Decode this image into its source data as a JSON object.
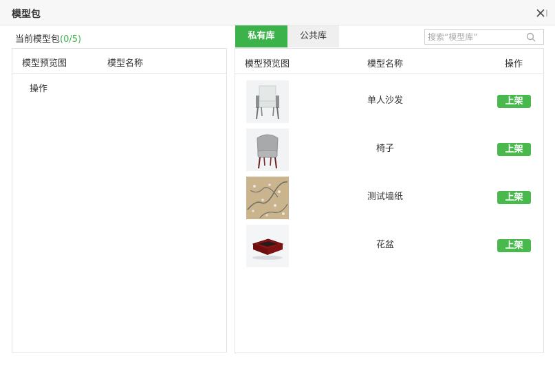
{
  "dialog": {
    "title": "模型包",
    "close_icon": "close-icon"
  },
  "left": {
    "caption_prefix": "当前模型包",
    "caption_count": "(0/5)",
    "headers": [
      "模型预览图",
      "模型名称"
    ],
    "op_label": "操作"
  },
  "tabs": [
    {
      "label": "私有库",
      "active": true
    },
    {
      "label": "公共库",
      "active": false
    }
  ],
  "search": {
    "placeholder": "搜索“模型库”",
    "value": "",
    "icon": "search-icon"
  },
  "right": {
    "headers": [
      "模型预览图",
      "模型名称",
      "操作"
    ],
    "rows": [
      {
        "name": "单人沙发",
        "action": "上架",
        "thumb": "white-armchair"
      },
      {
        "name": "椅子",
        "action": "上架",
        "thumb": "grey-tub-chair"
      },
      {
        "name": "测试墙纸",
        "action": "上架",
        "thumb": "floral-wallpaper"
      },
      {
        "name": "花盆",
        "action": "上架",
        "thumb": "red-planter-box"
      }
    ]
  },
  "colors": {
    "accent": "#3cb34a",
    "button": "#49b94d",
    "titlebar_bg": "#f7f7f7",
    "border": "#e3e3e3"
  }
}
